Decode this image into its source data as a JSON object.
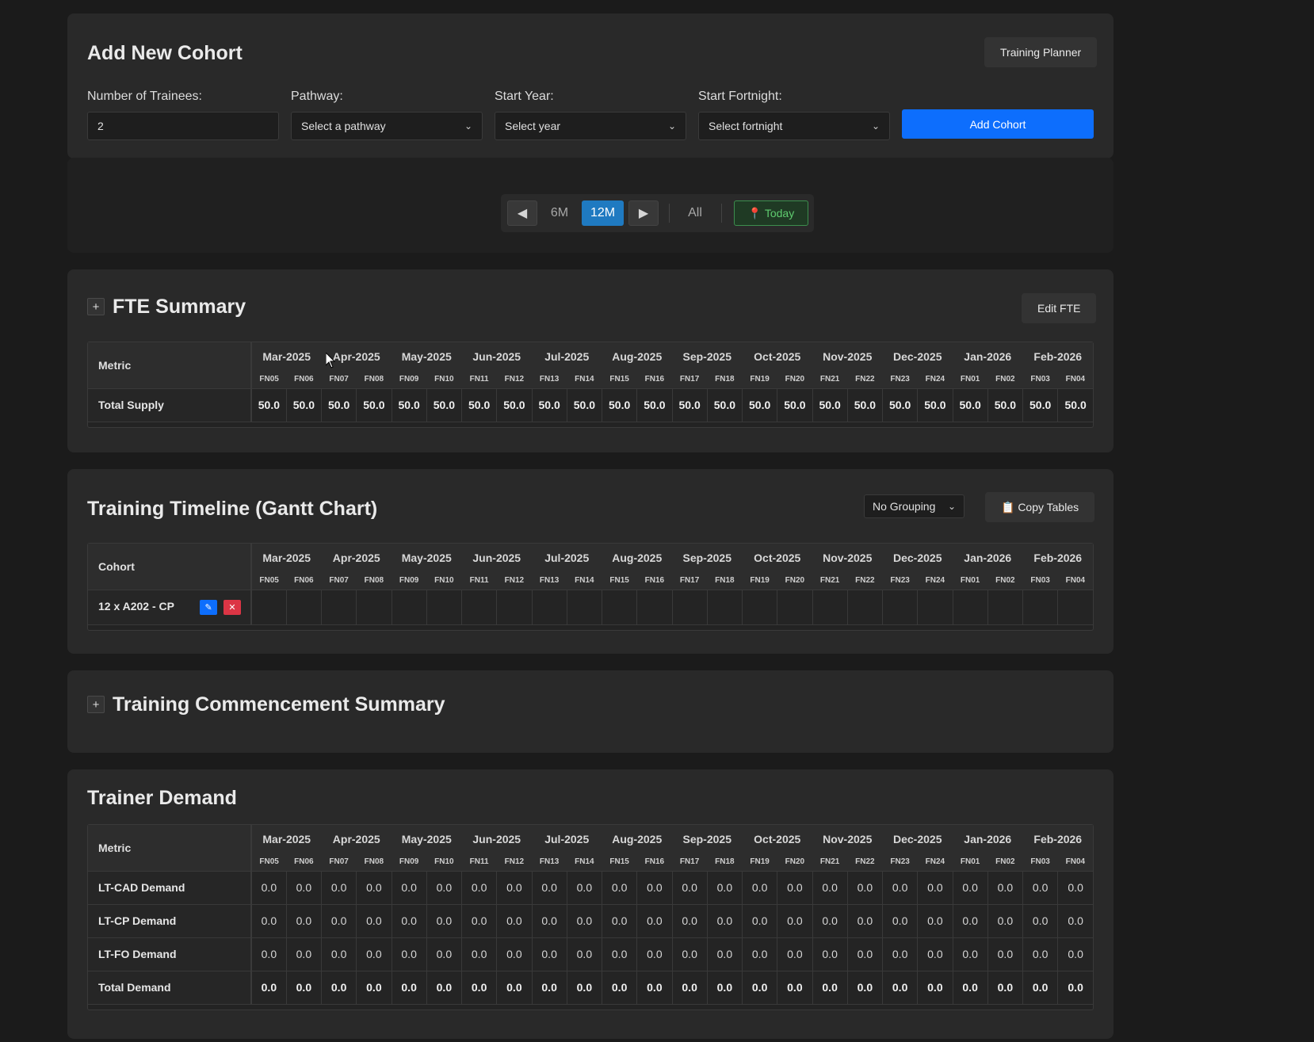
{
  "add_cohort": {
    "title": "Add New Cohort",
    "planner_button": "Training Planner",
    "trainees_label": "Number of Trainees:",
    "trainees_value": "2",
    "pathway_label": "Pathway:",
    "pathway_placeholder": "Select a pathway",
    "year_label": "Start Year:",
    "year_placeholder": "Select year",
    "fortnight_label": "Start Fortnight:",
    "fortnight_placeholder": "Select fortnight",
    "submit": "Add Cohort"
  },
  "nav": {
    "prev": "◀",
    "six_month": "6M",
    "twelve_month": "12M",
    "next": "▶",
    "all": "All",
    "today": "📍 Today",
    "active": "12M"
  },
  "months": [
    "Mar-2025",
    "Apr-2025",
    "May-2025",
    "Jun-2025",
    "Jul-2025",
    "Aug-2025",
    "Sep-2025",
    "Oct-2025",
    "Nov-2025",
    "Dec-2025",
    "Jan-2026",
    "Feb-2026"
  ],
  "fortnights": [
    "FN05",
    "FN06",
    "FN07",
    "FN08",
    "FN09",
    "FN10",
    "FN11",
    "FN12",
    "FN13",
    "FN14",
    "FN15",
    "FN16",
    "FN17",
    "FN18",
    "FN19",
    "FN20",
    "FN21",
    "FN22",
    "FN23",
    "FN24",
    "FN01",
    "FN02",
    "FN03",
    "FN04"
  ],
  "fte": {
    "expander": "+",
    "title": "FTE Summary",
    "edit_button": "Edit FTE",
    "header": "Metric",
    "rows": [
      {
        "label": "Total Supply",
        "bold": true,
        "values": [
          "50.0",
          "50.0",
          "50.0",
          "50.0",
          "50.0",
          "50.0",
          "50.0",
          "50.0",
          "50.0",
          "50.0",
          "50.0",
          "50.0",
          "50.0",
          "50.0",
          "50.0",
          "50.0",
          "50.0",
          "50.0",
          "50.0",
          "50.0",
          "50.0",
          "50.0",
          "50.0",
          "50.0"
        ]
      }
    ]
  },
  "gantt": {
    "title": "Training Timeline (Gantt Chart)",
    "grouping": "No Grouping",
    "copy_button": "📋 Copy Tables",
    "header": "Cohort",
    "cohorts": [
      {
        "label": "12 x A202 - CP",
        "edit_icon": "✎",
        "delete_icon": "✕"
      }
    ]
  },
  "commencement": {
    "expander": "+",
    "title": "Training Commencement Summary"
  },
  "trainer": {
    "title": "Trainer Demand",
    "header": "Metric",
    "rows": [
      {
        "label": "LT-CAD Demand",
        "bold": false,
        "values": [
          "0.0",
          "0.0",
          "0.0",
          "0.0",
          "0.0",
          "0.0",
          "0.0",
          "0.0",
          "0.0",
          "0.0",
          "0.0",
          "0.0",
          "0.0",
          "0.0",
          "0.0",
          "0.0",
          "0.0",
          "0.0",
          "0.0",
          "0.0",
          "0.0",
          "0.0",
          "0.0",
          "0.0"
        ]
      },
      {
        "label": "LT-CP Demand",
        "bold": false,
        "values": [
          "0.0",
          "0.0",
          "0.0",
          "0.0",
          "0.0",
          "0.0",
          "0.0",
          "0.0",
          "0.0",
          "0.0",
          "0.0",
          "0.0",
          "0.0",
          "0.0",
          "0.0",
          "0.0",
          "0.0",
          "0.0",
          "0.0",
          "0.0",
          "0.0",
          "0.0",
          "0.0",
          "0.0"
        ]
      },
      {
        "label": "LT-FO Demand",
        "bold": false,
        "values": [
          "0.0",
          "0.0",
          "0.0",
          "0.0",
          "0.0",
          "0.0",
          "0.0",
          "0.0",
          "0.0",
          "0.0",
          "0.0",
          "0.0",
          "0.0",
          "0.0",
          "0.0",
          "0.0",
          "0.0",
          "0.0",
          "0.0",
          "0.0",
          "0.0",
          "0.0",
          "0.0",
          "0.0"
        ]
      },
      {
        "label": "Total Demand",
        "bold": true,
        "values": [
          "0.0",
          "0.0",
          "0.0",
          "0.0",
          "0.0",
          "0.0",
          "0.0",
          "0.0",
          "0.0",
          "0.0",
          "0.0",
          "0.0",
          "0.0",
          "0.0",
          "0.0",
          "0.0",
          "0.0",
          "0.0",
          "0.0",
          "0.0",
          "0.0",
          "0.0",
          "0.0",
          "0.0"
        ]
      }
    ]
  },
  "colors": {
    "primary": "#0d6efd",
    "active_nav": "#1f7ac1",
    "today_green": "#5fcc6f",
    "delete_red": "#dc3545"
  }
}
